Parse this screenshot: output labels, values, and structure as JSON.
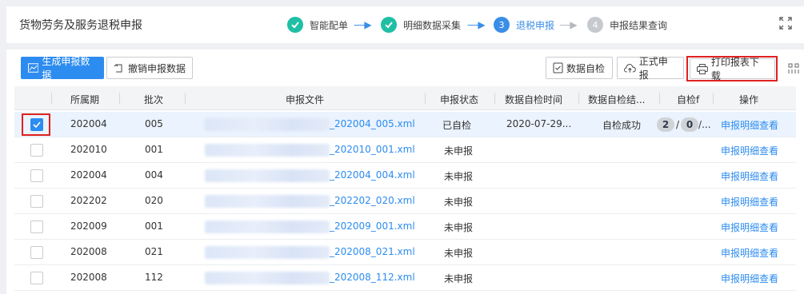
{
  "header": {
    "title": "货物劳务及服务退税申报",
    "steps": [
      {
        "num": "",
        "label": "智能配单",
        "state": "done"
      },
      {
        "num": "",
        "label": "明细数据采集",
        "state": "done"
      },
      {
        "num": "3",
        "label": "退税申报",
        "state": "active"
      },
      {
        "num": "4",
        "label": "申报结果查询",
        "state": "todo"
      }
    ],
    "arrow": "----▶"
  },
  "toolbar": {
    "generate_label": "生成申报数据",
    "revoke_label": "撤销申报数据",
    "selfcheck_label": "数据自检",
    "formal_label": "正式申报",
    "print_label": "打印报表下载"
  },
  "table": {
    "columns": [
      "所属期",
      "批次",
      "申报文件",
      "申报状态",
      "数据自检时间",
      "数据自检结...",
      "自检f",
      "操作"
    ],
    "rows": [
      {
        "period": "202004",
        "batch": "005",
        "file": "_202004_005.xml",
        "status": "已自检",
        "check_time": "2020-07-29...",
        "check_result": "自检成功",
        "count_a": "2",
        "count_b": "0",
        "tail": "/...",
        "action": "申报明细查看",
        "selected": true
      },
      {
        "period": "202010",
        "batch": "001",
        "file": "_202010_001.xml",
        "status": "未申报",
        "check_time": "",
        "check_result": "",
        "action": "申报明细查看",
        "selected": false
      },
      {
        "period": "202004",
        "batch": "004",
        "file": "_202004_004.xml",
        "status": "未申报",
        "check_time": "",
        "check_result": "",
        "action": "申报明细查看",
        "selected": false
      },
      {
        "period": "202202",
        "batch": "020",
        "file": "_202202_020.xml",
        "status": "未申报",
        "check_time": "",
        "check_result": "",
        "action": "申报明细查看",
        "selected": false
      },
      {
        "period": "202009",
        "batch": "001",
        "file": "_202009_001.xml",
        "status": "未申报",
        "check_time": "",
        "check_result": "",
        "action": "申报明细查看",
        "selected": false
      },
      {
        "period": "202008",
        "batch": "021",
        "file": "_202008_021.xml",
        "status": "未申报",
        "check_time": "",
        "check_result": "",
        "action": "申报明细查看",
        "selected": false
      },
      {
        "period": "202008",
        "batch": "112",
        "file": "_202008_112.xml",
        "status": "未申报",
        "check_time": "",
        "check_result": "",
        "action": "申报明细查看",
        "selected": false
      }
    ]
  },
  "colors": {
    "primary": "#2d8cf0",
    "done": "#1fbfa6",
    "highlight": "#e02020"
  }
}
